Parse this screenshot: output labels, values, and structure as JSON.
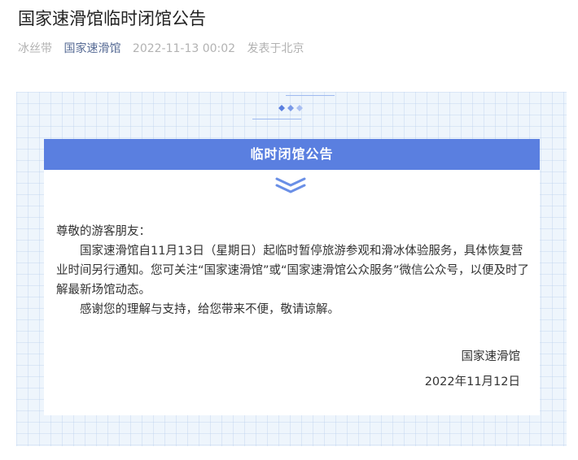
{
  "article": {
    "title": "国家速滑馆临时闭馆公告",
    "meta": {
      "author": "冰丝带",
      "account": "国家速滑馆",
      "datetime": "2022-11-13 00:02",
      "location": "发表于北京"
    }
  },
  "poster": {
    "banner_title": "临时闭馆公告",
    "greeting": "尊敬的游客朋友：",
    "paragraphs": [
      "国家速滑馆自11月13日（星期日）起临时暂停旅游参观和滑冰体验服务，具体恢复营业时间另行通知。您可关注“国家速滑馆”或“国家速滑馆公众服务”微信公众号，以便及时了解最新场馆动态。",
      "感谢您的理解与支持，给您带来不便，敬请谅解。"
    ],
    "signature": "国家速滑馆",
    "date": "2022年11月12日"
  },
  "colors": {
    "banner": "#5a7fe0",
    "accent": "#6a8fe6",
    "account_link": "#576b95",
    "poster_bg": "#eef5fc"
  }
}
